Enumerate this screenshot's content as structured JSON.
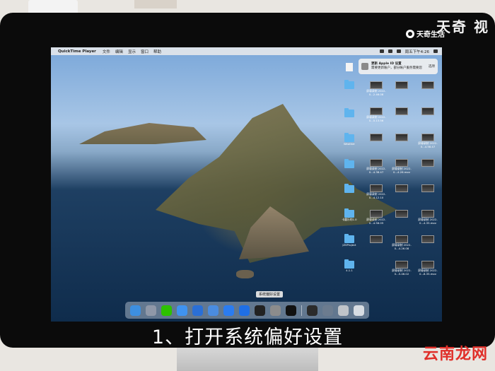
{
  "watermark": {
    "top": "天奇 视",
    "logo_text": "天奇生活",
    "source": "云南龙网"
  },
  "menubar": {
    "apple_icon": "apple-icon",
    "app_name": "QuickTime Player",
    "items": [
      "文件",
      "编辑",
      "显示",
      "窗口",
      "帮助"
    ],
    "clock": "周五下午4:26"
  },
  "notification": {
    "title": "更新 Apple ID 设置",
    "body": "需要更新账户，部分帐户服务需要您",
    "button": "选项"
  },
  "desktop": {
    "labels": [
      "屏幕录制 2022-0...2.46.08",
      "屏幕录制 2022-0...5.13.56",
      "屏幕录制 2022-0...4.58.47",
      "Weather",
      "屏幕录制 2022-0...4.38.47",
      "屏幕录制 2022-0...4.26.mov",
      "屏幕录制 2022-0...4.12.10",
      "屏幕录制 2022-0...4.58.05",
      "屏幕录制 2022-0...4.35.mov",
      "屏幕录制 2022-0...4.26.08",
      "屏幕录制 2022-0...5.46.02",
      "屏幕录制 2022-0...8.35.mov",
      "卡圆乐的1.0",
      "JZ0Project",
      "4.1.1"
    ]
  },
  "dock": {
    "tooltip": "系统偏好设置",
    "icons": [
      {
        "name": "finder-icon",
        "color": "#3d8fe0"
      },
      {
        "name": "launchpad-icon",
        "color": "#8f98a8"
      },
      {
        "name": "wechat-icon",
        "color": "#2dc100"
      },
      {
        "name": "safari-icon",
        "color": "#3f93f0"
      },
      {
        "name": "xcode-icon",
        "color": "#2a6fd6"
      },
      {
        "name": "finder-folder-icon",
        "color": "#4a8ce0"
      },
      {
        "name": "app-store-icon",
        "color": "#2b7cf0"
      },
      {
        "name": "upload-icon",
        "color": "#1f6fe6"
      },
      {
        "name": "terminal-icon",
        "color": "#222222"
      },
      {
        "name": "system-preferences-icon",
        "color": "#8c8c8c"
      },
      {
        "name": "qq-icon",
        "color": "#111111"
      },
      {
        "name": "quicktime-icon",
        "color": "#2b2b2b"
      },
      {
        "name": "network-utility-icon",
        "color": "#6c7c8f"
      },
      {
        "name": "disk-utility-icon",
        "color": "#c0c4c9"
      },
      {
        "name": "trash-icon",
        "color": "#d7dce2"
      }
    ]
  },
  "subtitle": "1、打开系统偏好设置"
}
